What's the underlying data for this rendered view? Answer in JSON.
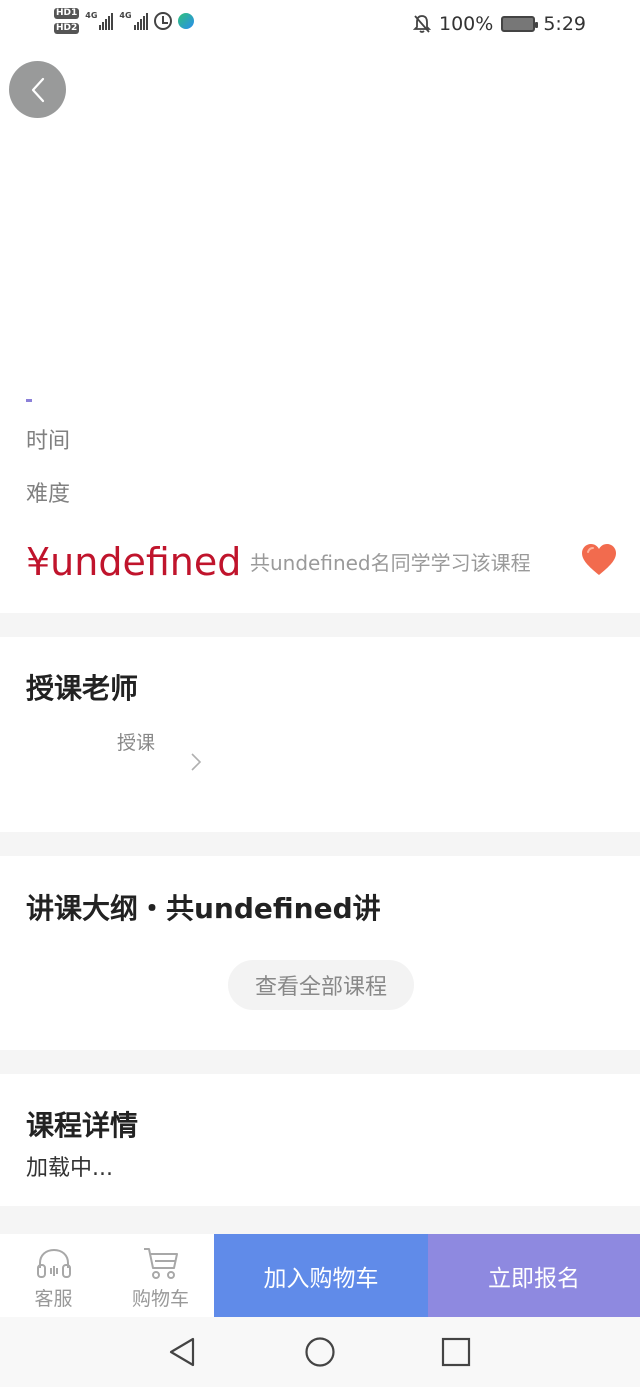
{
  "status_bar": {
    "hd1": "HD1",
    "hd2": "HD2",
    "net1": "4G",
    "net2": "4G",
    "battery": "100%",
    "time": "5:29",
    "icons": [
      "signal-icon",
      "alarm-icon",
      "app-icon",
      "mute-bell-icon",
      "battery-icon"
    ]
  },
  "course": {
    "time_label": "时间",
    "difficulty_label": "难度",
    "price": "¥undefined",
    "students": "共undefined名同学学习该课程",
    "accent_color": "#8b80d8",
    "price_color": "#c0142c"
  },
  "teacher_section": {
    "title": "授课老师",
    "role": "授课"
  },
  "outline_section": {
    "title": "讲课大纲・共undefined讲",
    "view_all": "查看全部课程"
  },
  "detail_section": {
    "title": "课程详情",
    "loading": "加载中..."
  },
  "bottom_bar": {
    "service_label": "客服",
    "cart_label": "购物车",
    "add_cart": "加入购物车",
    "enroll": "立即报名",
    "add_cart_color": "#608be9",
    "enroll_color": "#8e89e0"
  }
}
